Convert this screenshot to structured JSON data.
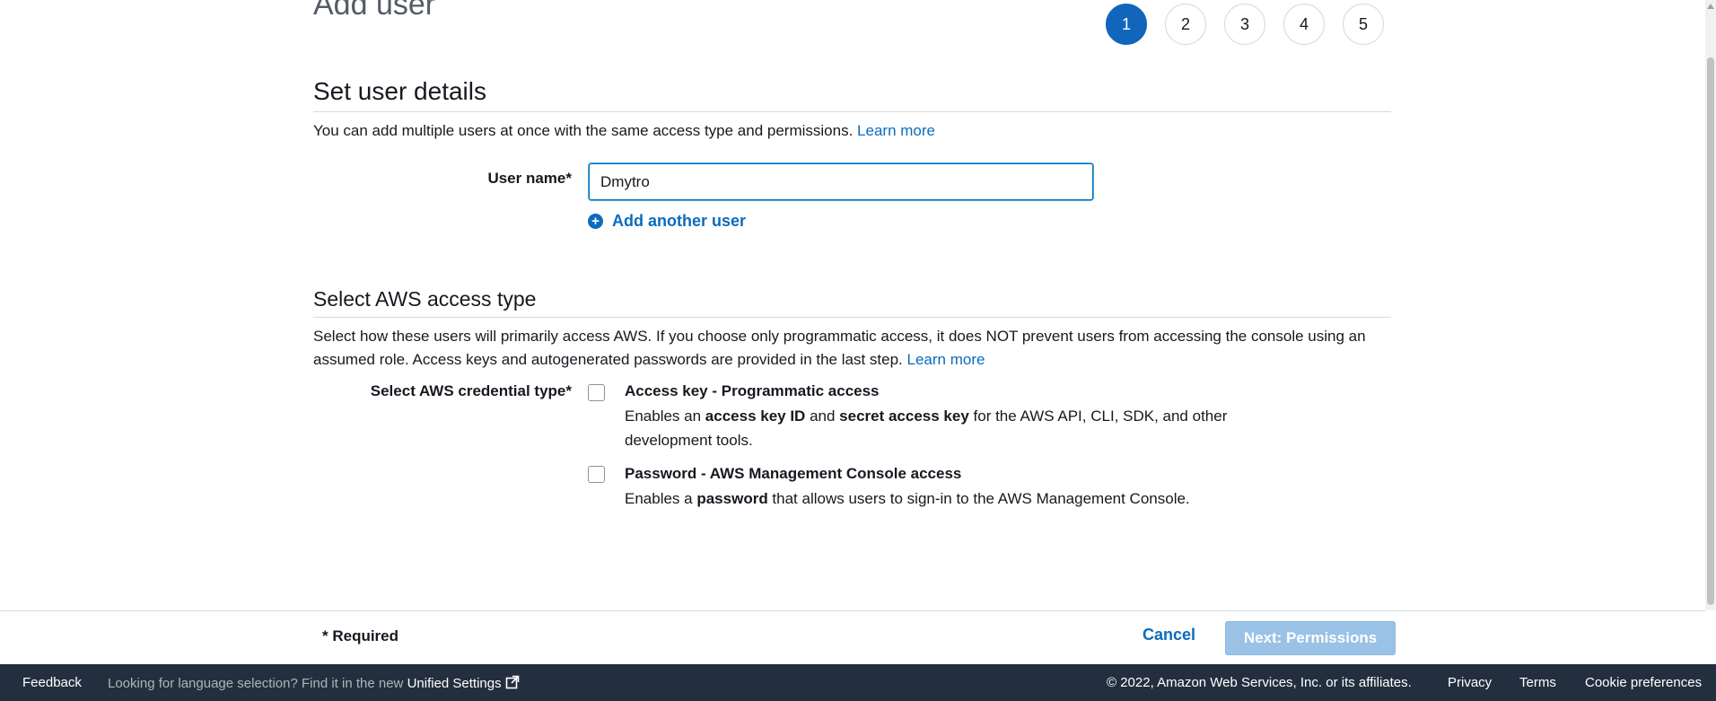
{
  "header": {
    "title": "Add user",
    "steps": [
      "1",
      "2",
      "3",
      "4",
      "5"
    ],
    "active_step": "1"
  },
  "user_details": {
    "heading": "Set user details",
    "description": "You can add multiple users at once with the same access type and permissions.",
    "learn_more": "Learn more",
    "user_name_label": "User name*",
    "user_name_value": "Dmytro",
    "add_another_user": "Add another user"
  },
  "access_type": {
    "heading": "Select AWS access type",
    "description": "Select how these users will primarily access AWS. If you choose only programmatic access, it does NOT prevent users from accessing the console using an assumed role. Access keys and autogenerated passwords are provided in the last step.",
    "learn_more": "Learn more",
    "credential_label": "Select AWS credential type*",
    "options": [
      {
        "title": "Access key - Programmatic access",
        "desc_pre": "Enables an ",
        "desc_b1": "access key ID",
        "desc_mid": " and ",
        "desc_b2": "secret access key",
        "desc_post": " for the AWS API, CLI, SDK, and other development tools.",
        "checked": false
      },
      {
        "title": "Password - AWS Management Console access",
        "desc_pre": "Enables a ",
        "desc_b1": "password",
        "desc_post": " that allows users to sign-in to the AWS Management Console.",
        "checked": false
      }
    ]
  },
  "action_bar": {
    "required_note": "* Required",
    "cancel": "Cancel",
    "next": "Next: Permissions"
  },
  "footer": {
    "feedback": "Feedback",
    "language_note": "Looking for language selection? Find it in the new",
    "unified_settings": "Unified Settings",
    "copyright": "© 2022, Amazon Web Services, Inc. or its affiliates.",
    "privacy": "Privacy",
    "terms": "Terms",
    "cookie_preferences": "Cookie preferences"
  },
  "colors": {
    "primary": "#1166bb",
    "link": "#0b6cbd",
    "disabled_button": "#9ac2e6",
    "footer_bg": "#232f3e"
  }
}
